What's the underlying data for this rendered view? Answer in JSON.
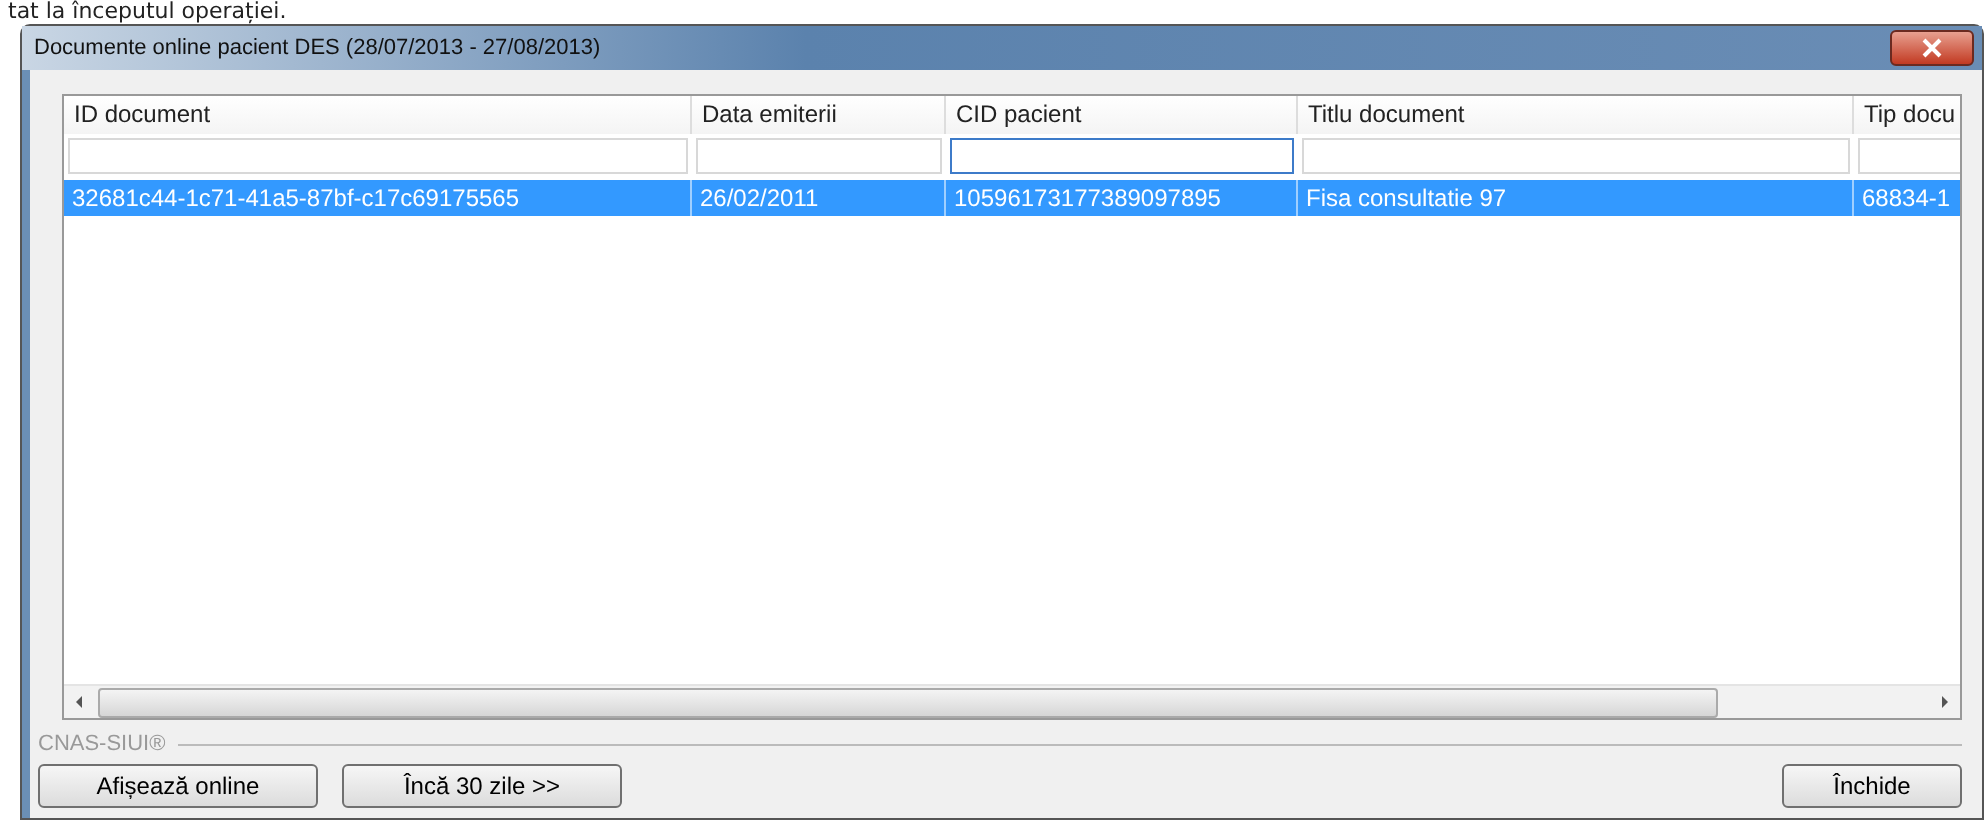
{
  "background_text": "tat la începutul operației.",
  "window": {
    "title": "Documente online pacient DES (28/07/2013 - 27/08/2013)"
  },
  "table": {
    "columns": [
      {
        "label": "ID document",
        "filter_focused": false
      },
      {
        "label": "Data emiterii",
        "filter_focused": false
      },
      {
        "label": "CID pacient",
        "filter_focused": true
      },
      {
        "label": "Titlu document",
        "filter_focused": false
      },
      {
        "label": "Tip docu",
        "filter_focused": false
      }
    ],
    "rows": [
      {
        "selected": true,
        "cells": [
          "32681c44-1c71-41a5-87bf-c17c69175565",
          "26/02/2011",
          "10596173177389097895",
          "Fisa consultatie 97",
          "68834-1"
        ]
      }
    ]
  },
  "group_label": "CNAS-SIUI®",
  "buttons": [
    "Afișează online",
    "Încă 30 zile >>"
  ],
  "close_button": "Închide"
}
